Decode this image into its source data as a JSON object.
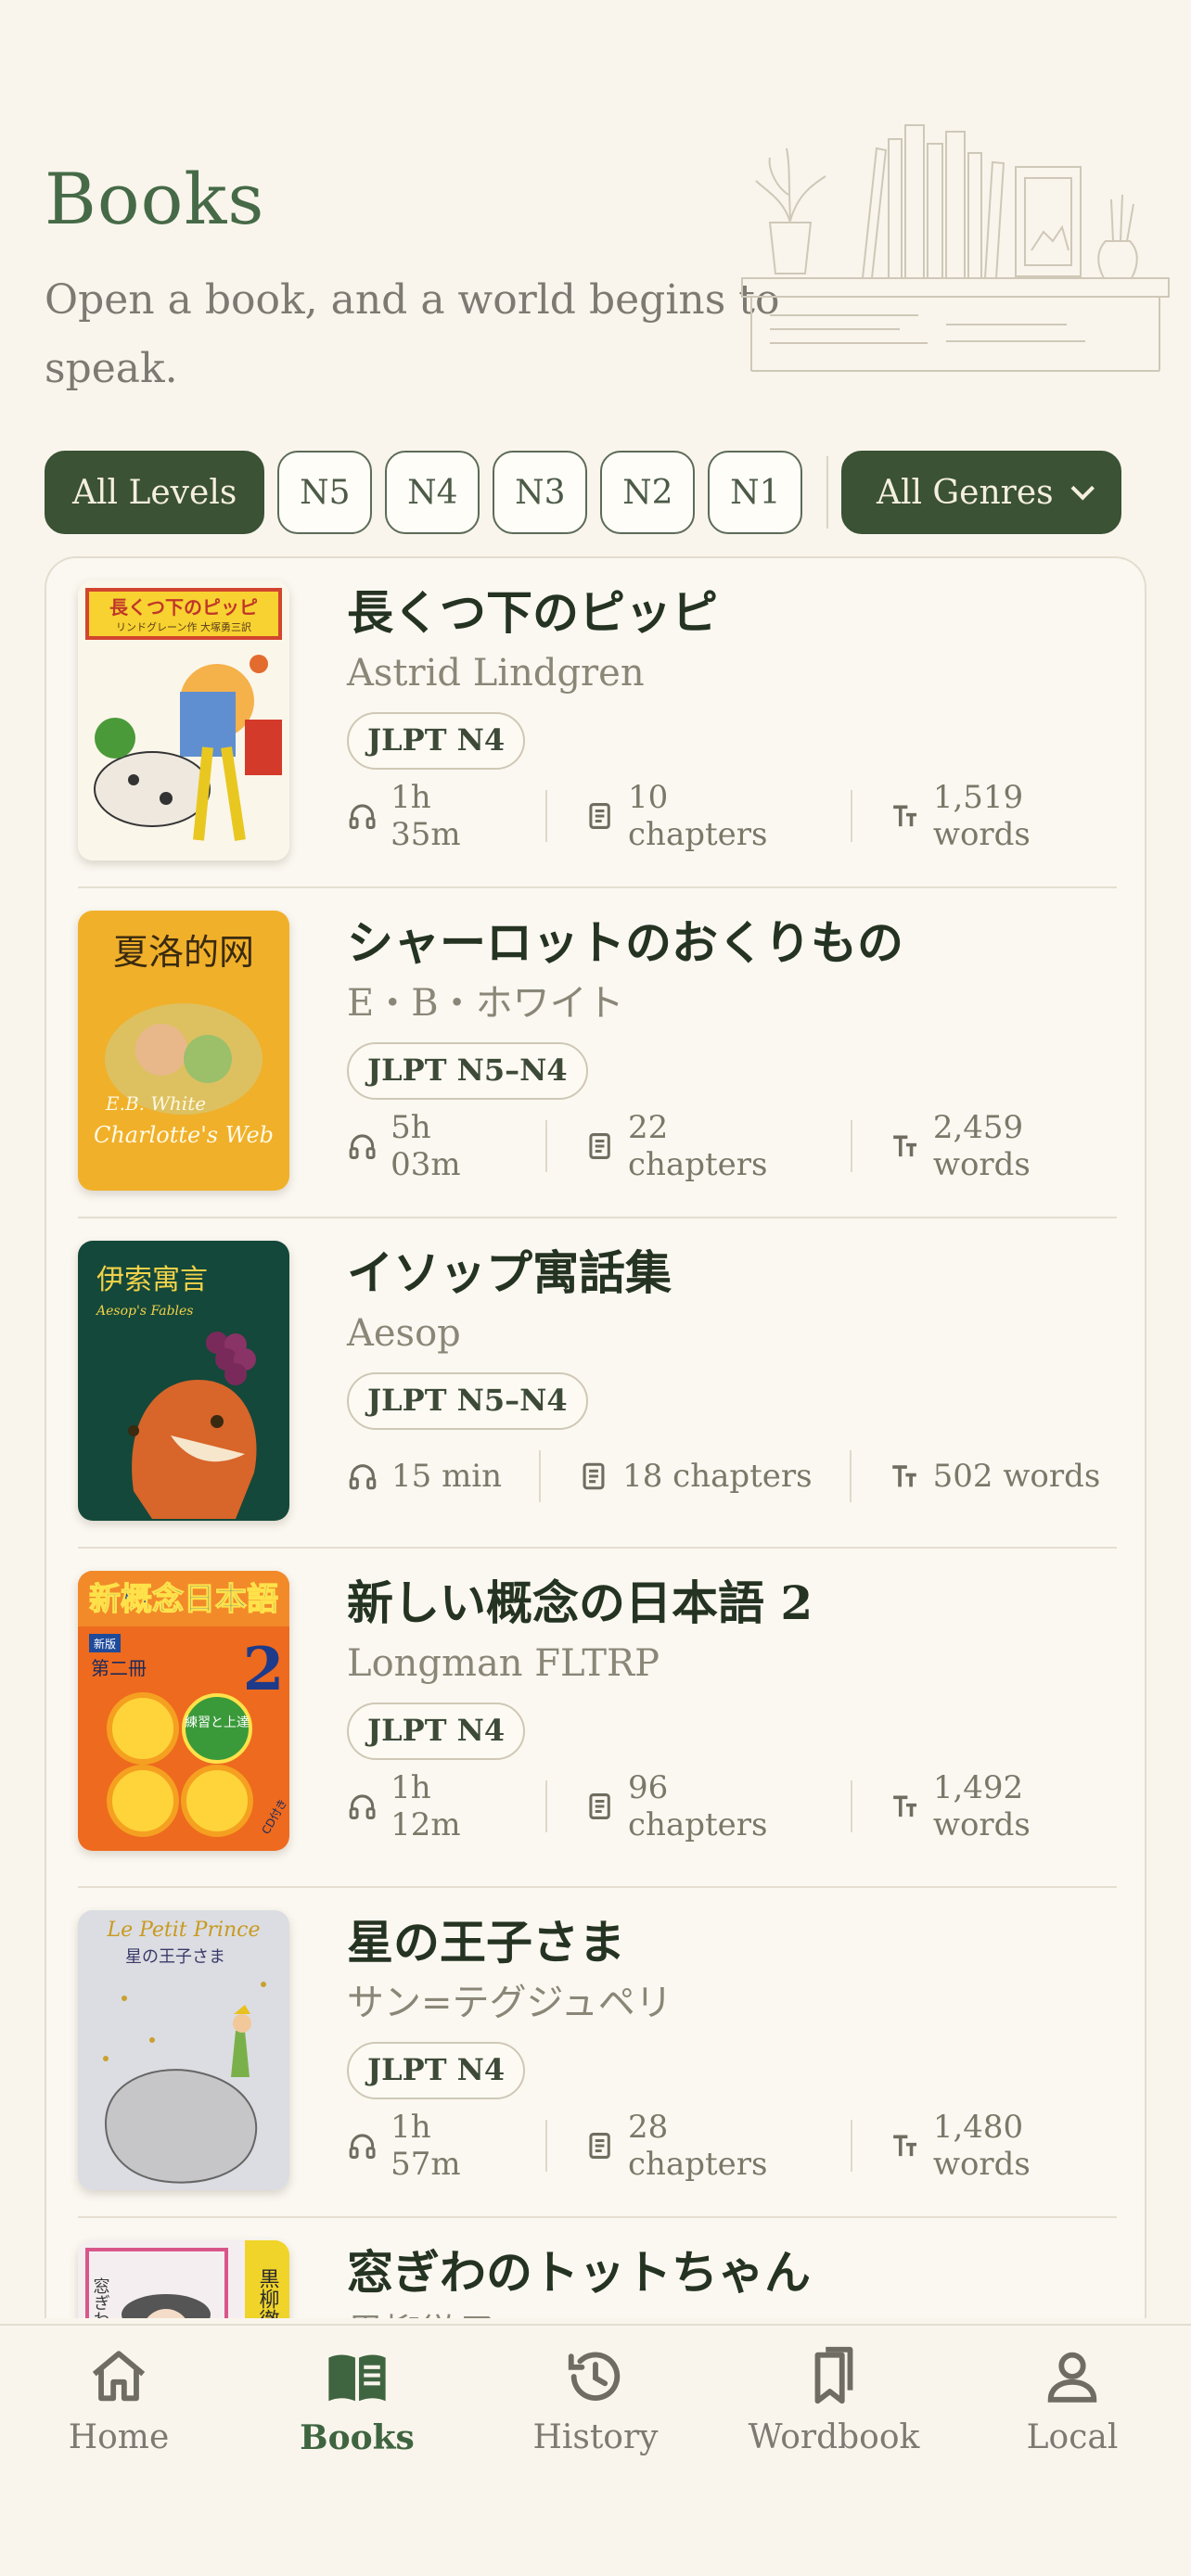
{
  "header": {
    "title": "Books",
    "subtitle": "Open a book, and a world begins to speak."
  },
  "filters": {
    "levels": [
      "All Levels",
      "N5",
      "N4",
      "N3",
      "N2",
      "N1"
    ],
    "active_level": "All Levels",
    "genre": "All Genres"
  },
  "books": [
    {
      "title": "長くつ下のピッピ",
      "author": "Astrid Lindgren",
      "level": "JLPT N4",
      "duration": "1h 35m",
      "chapters": "10 chapters",
      "words": "1,519 words"
    },
    {
      "title": "シャーロットのおくりもの",
      "author": "E・B・ホワイト",
      "level": "JLPT N5–N4",
      "duration": "5h 03m",
      "chapters": "22 chapters",
      "words": "2,459 words"
    },
    {
      "title": "イソップ寓話集",
      "author": "Aesop",
      "level": "JLPT N5–N4",
      "duration": "15 min",
      "chapters": "18 chapters",
      "words": "502 words"
    },
    {
      "title": "新しい概念の日本語 2",
      "author": "Longman FLTRP",
      "level": "JLPT N4",
      "duration": "1h 12m",
      "chapters": "96 chapters",
      "words": "1,492 words"
    },
    {
      "title": "星の王子さま",
      "author": "サン=テグジュペリ",
      "level": "JLPT N4",
      "duration": "1h 57m",
      "chapters": "28 chapters",
      "words": "1,480 words"
    },
    {
      "title": "窓ぎわのトットちゃん",
      "author": "黒柳徹子",
      "level": "",
      "duration": "",
      "chapters": "",
      "words": ""
    }
  ],
  "covers": {
    "c1": {
      "title": "長くつ下のピッピ",
      "sub": "リンドグレーン作 大塚勇三訳"
    },
    "c2": {
      "title": "夏洛的网",
      "sub": "Charlotte's Web",
      "author": "E.B. White"
    },
    "c3": {
      "title": "伊索寓言",
      "sub": "Aesop's Fables"
    },
    "c4": {
      "title": "新概念日本語",
      "num": "2",
      "vol": "第二冊",
      "badge": "練習と上達",
      "edition": "新版",
      "tag": "CD付き"
    },
    "c5": {
      "title": "Le Petit Prince",
      "sub": "星の王子さま"
    },
    "c6": {
      "title": "窓ぎわのトットちゃん",
      "author": "黒柳徹子"
    }
  },
  "tabs": [
    {
      "label": "Home",
      "icon": "home-icon"
    },
    {
      "label": "Books",
      "icon": "book-open-icon"
    },
    {
      "label": "History",
      "icon": "history-icon"
    },
    {
      "label": "Wordbook",
      "icon": "bookmarks-icon"
    },
    {
      "label": "Local",
      "icon": "person-icon"
    }
  ],
  "active_tab": "Books",
  "colors": {
    "accent": "#3b5234",
    "title": "#466a47",
    "background": "#f9f5ec"
  }
}
